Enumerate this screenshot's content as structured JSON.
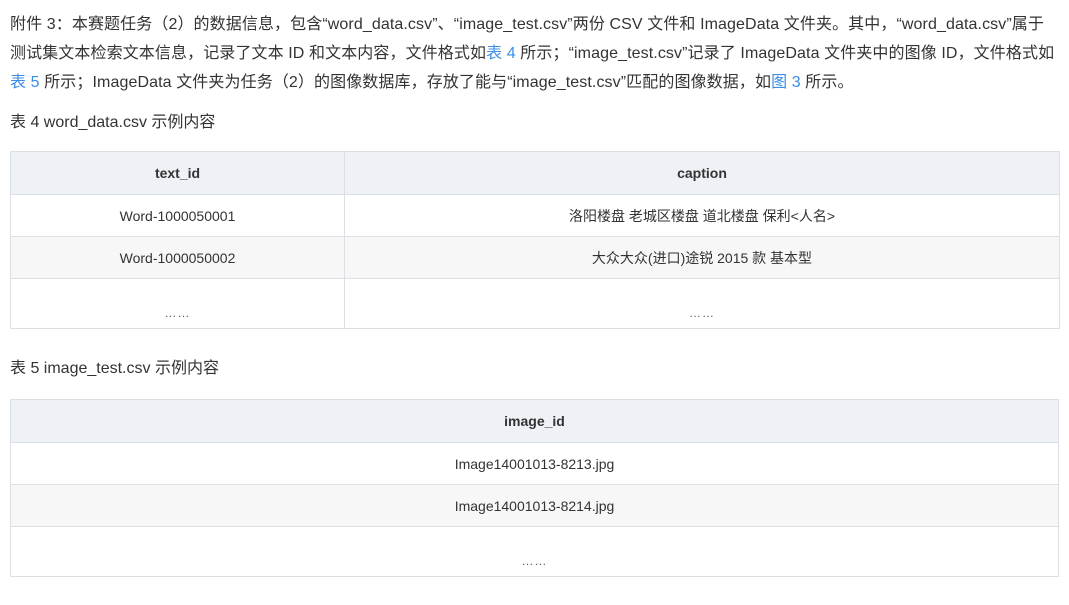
{
  "intro": {
    "part1": "附件 3：本赛题任务（2）的数据信息，包含“word_data.csv”、“image_test.csv”两份 CSV 文件和 ImageData 文件夹。其中，“word_data.csv”属于测试集文本检索文本信息，记录了文本 ID 和文本内容，文件格式如",
    "link1": "表 4",
    "part2": " 所示；“image_test.csv”记录了 ImageData 文件夹中的图像 ID，文件格式如",
    "link2": "表 5",
    "part3": " 所示；ImageData 文件夹为任务（2）的图像数据库，存放了能与“image_test.csv”匹配的图像数据，如",
    "link3": "图 3",
    "part4": " 所示。"
  },
  "table4": {
    "caption": "表 4 word_data.csv 示例内容",
    "headers": [
      "text_id",
      "caption"
    ],
    "rows": [
      [
        "Word-1000050001",
        "洛阳楼盘 老城区楼盘 道北楼盘 保利<人名>"
      ],
      [
        "Word-1000050002",
        "大众大众(进口)途锐 2015 款 基本型"
      ],
      [
        "……",
        "……"
      ]
    ]
  },
  "table5": {
    "caption": "表 5 image_test.csv 示例内容",
    "headers": [
      "image_id"
    ],
    "rows": [
      [
        "Image14001013-8213.jpg"
      ],
      [
        "Image14001013-8214.jpg"
      ],
      [
        "……"
      ]
    ]
  },
  "colors": {
    "link": "#3a8ee6",
    "header_bg": "#eef1f5",
    "stripe_bg": "#f7f7f7",
    "border": "#dcdfe6"
  }
}
